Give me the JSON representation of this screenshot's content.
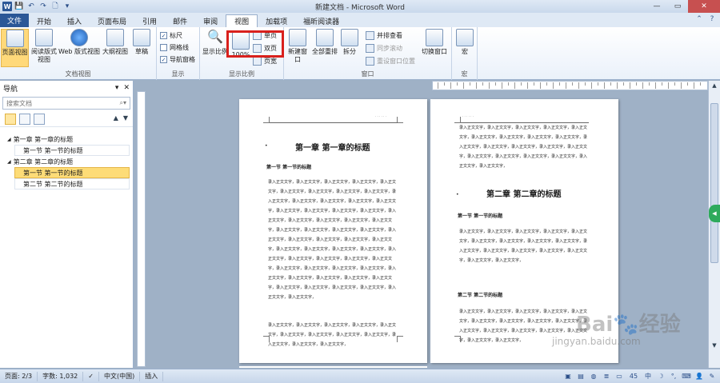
{
  "window": {
    "title": "新建文档 - Microsoft Word"
  },
  "tabs": {
    "file": "文件",
    "items": [
      "开始",
      "插入",
      "页面布局",
      "引用",
      "邮件",
      "审阅",
      "视图",
      "加载项",
      "福昕阅读器"
    ],
    "active_index": 6
  },
  "ribbon": {
    "doc_views": {
      "label": "文档视图",
      "page_view": "页面视图",
      "reading": "阅读版式\n视图",
      "web": "Web 版式视图",
      "outline": "大纲视图",
      "draft": "草稿"
    },
    "show": {
      "label": "显示",
      "ruler": "标尺",
      "gridlines": "网格线",
      "nav_pane": "导航窗格"
    },
    "zoom": {
      "label": "显示比例",
      "zoom": "显示比例",
      "hundred": "100%",
      "one_page": "单页",
      "two_pages": "双页",
      "page_width": "页宽"
    },
    "window": {
      "label": "窗口",
      "new_window": "新建窗口",
      "arrange_all": "全部重排",
      "split": "拆分",
      "side_by_side": "并排查看",
      "sync_scroll": "同步滚动",
      "reset_pos": "重设窗口位置",
      "switch": "切换窗口"
    },
    "macros": {
      "label": "宏",
      "macros": "宏"
    }
  },
  "nav": {
    "title": "导航",
    "search_placeholder": "搜索文档",
    "tree": [
      {
        "text": "第一章 第一章的标题",
        "level": 1
      },
      {
        "text": "第一节 第一节的标题",
        "level": 2
      },
      {
        "text": "第二章 第二章的标题",
        "level": 1
      },
      {
        "text": "第一节 第一节的标题",
        "level": 2,
        "selected": true
      },
      {
        "text": "第二节 第二节的标题",
        "level": 2
      }
    ]
  },
  "doc": {
    "ch1": "第一章 第一章的标题",
    "ch2": "第二章 第二章的标题",
    "sec1": "第一节 第一节的标题",
    "sec2": "第二节 第二节的标题",
    "body": "录入正文文字，录入正文文字，录入正文文字，录入正文文字，"
  },
  "status": {
    "page": "页面: 2/3",
    "words": "字数: 1,032",
    "lang": "中文(中国)",
    "mode": "插入",
    "zoom": "45"
  },
  "watermark": {
    "brand": "Bai🐾经验",
    "url": "jingyan.baidu.com"
  }
}
